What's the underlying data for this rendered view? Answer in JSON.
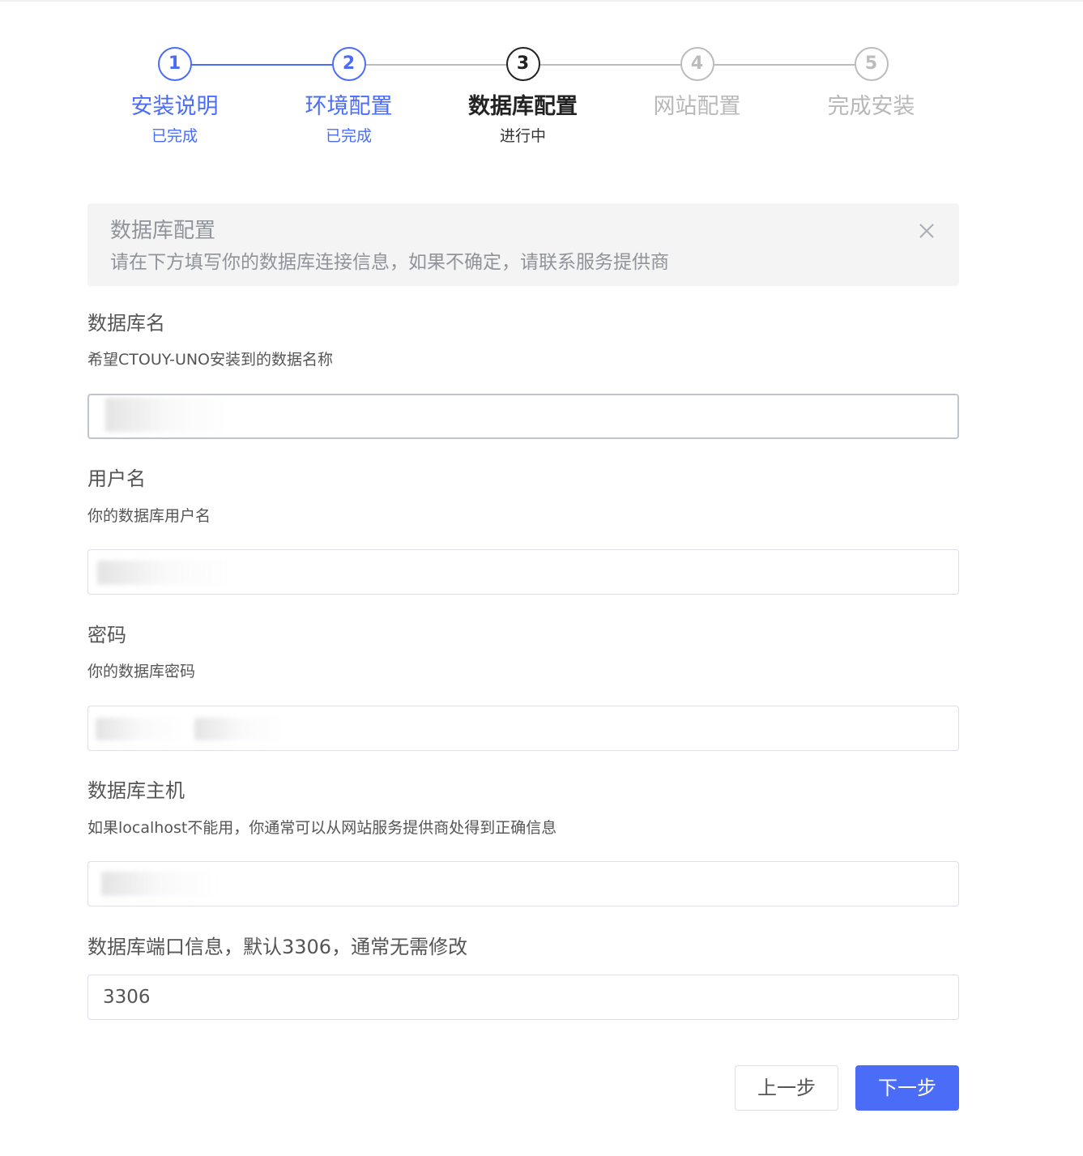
{
  "steps": [
    {
      "number": "1",
      "title": "安装说明",
      "status": "已完成",
      "state": "done"
    },
    {
      "number": "2",
      "title": "环境配置",
      "status": "已完成",
      "state": "done"
    },
    {
      "number": "3",
      "title": "数据库配置",
      "status": "进行中",
      "state": "active"
    },
    {
      "number": "4",
      "title": "网站配置",
      "status": "",
      "state": "pending"
    },
    {
      "number": "5",
      "title": "完成安装",
      "status": "",
      "state": "pending"
    }
  ],
  "alert": {
    "title": "数据库配置",
    "description": "请在下方填写你的数据库连接信息，如果不确定，请联系服务提供商",
    "close_icon": "close-icon"
  },
  "form": {
    "db_name": {
      "label": "数据库名",
      "help": "希望CTOUY-UNO安装到的数据名称",
      "value": ""
    },
    "username": {
      "label": "用户名",
      "help": "你的数据库用户名",
      "value": ""
    },
    "password": {
      "label": "密码",
      "help": "你的数据库密码",
      "value": ""
    },
    "host": {
      "label": "数据库主机",
      "help": "如果localhost不能用，你通常可以从网站服务提供商处得到正确信息",
      "value": ""
    },
    "port": {
      "label": "数据库端口信息，默认3306，通常无需修改",
      "value": "3306"
    }
  },
  "buttons": {
    "prev": "上一步",
    "next": "下一步"
  },
  "colors": {
    "accent": "#4a6cf7",
    "active": "#222222",
    "pending": "#bcbcbc",
    "alert_bg": "#f4f4f5"
  }
}
